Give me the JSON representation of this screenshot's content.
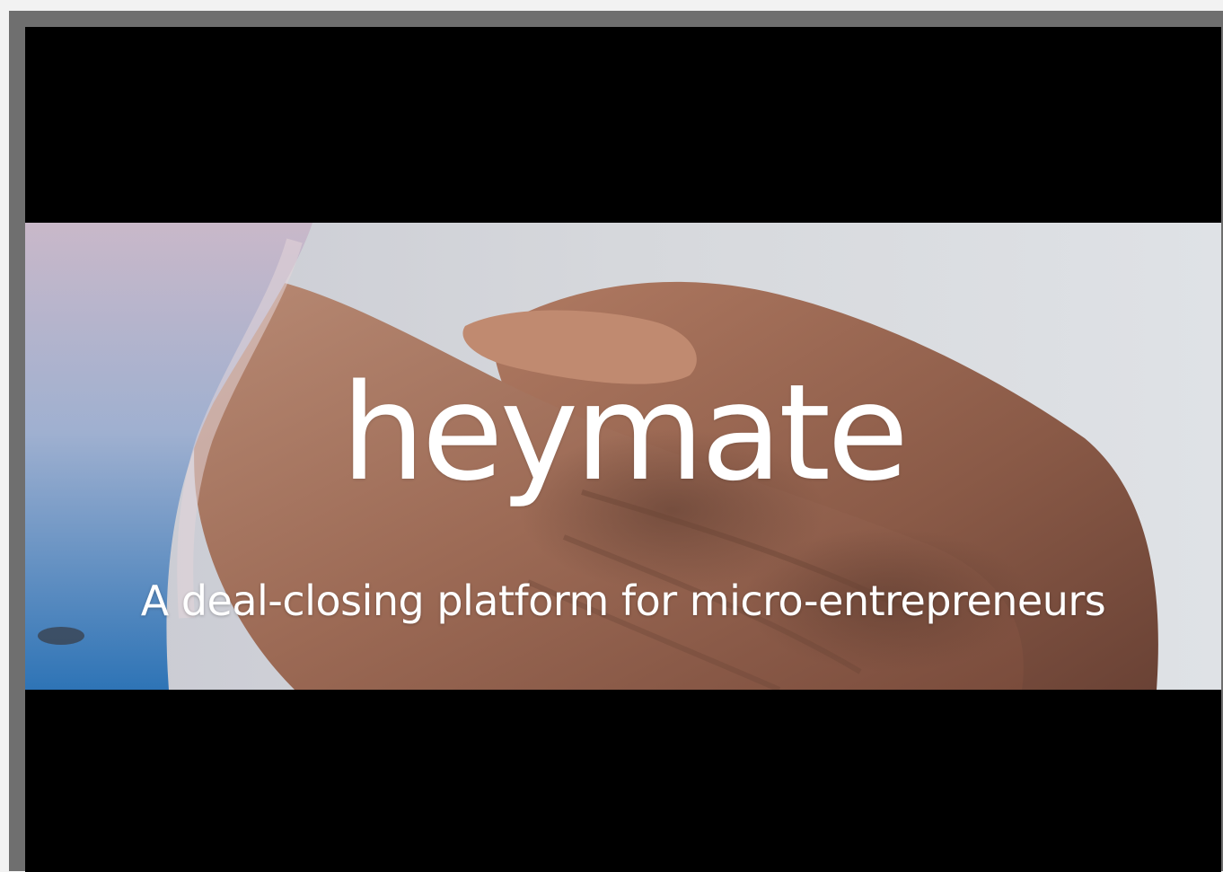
{
  "banner": {
    "brand": "heymate",
    "tagline": "A deal-closing platform for micro-entrepreneurs"
  },
  "colors": {
    "frame_border": "#6f6f6f",
    "letterbox": "#000000",
    "text": "#ffffff"
  }
}
